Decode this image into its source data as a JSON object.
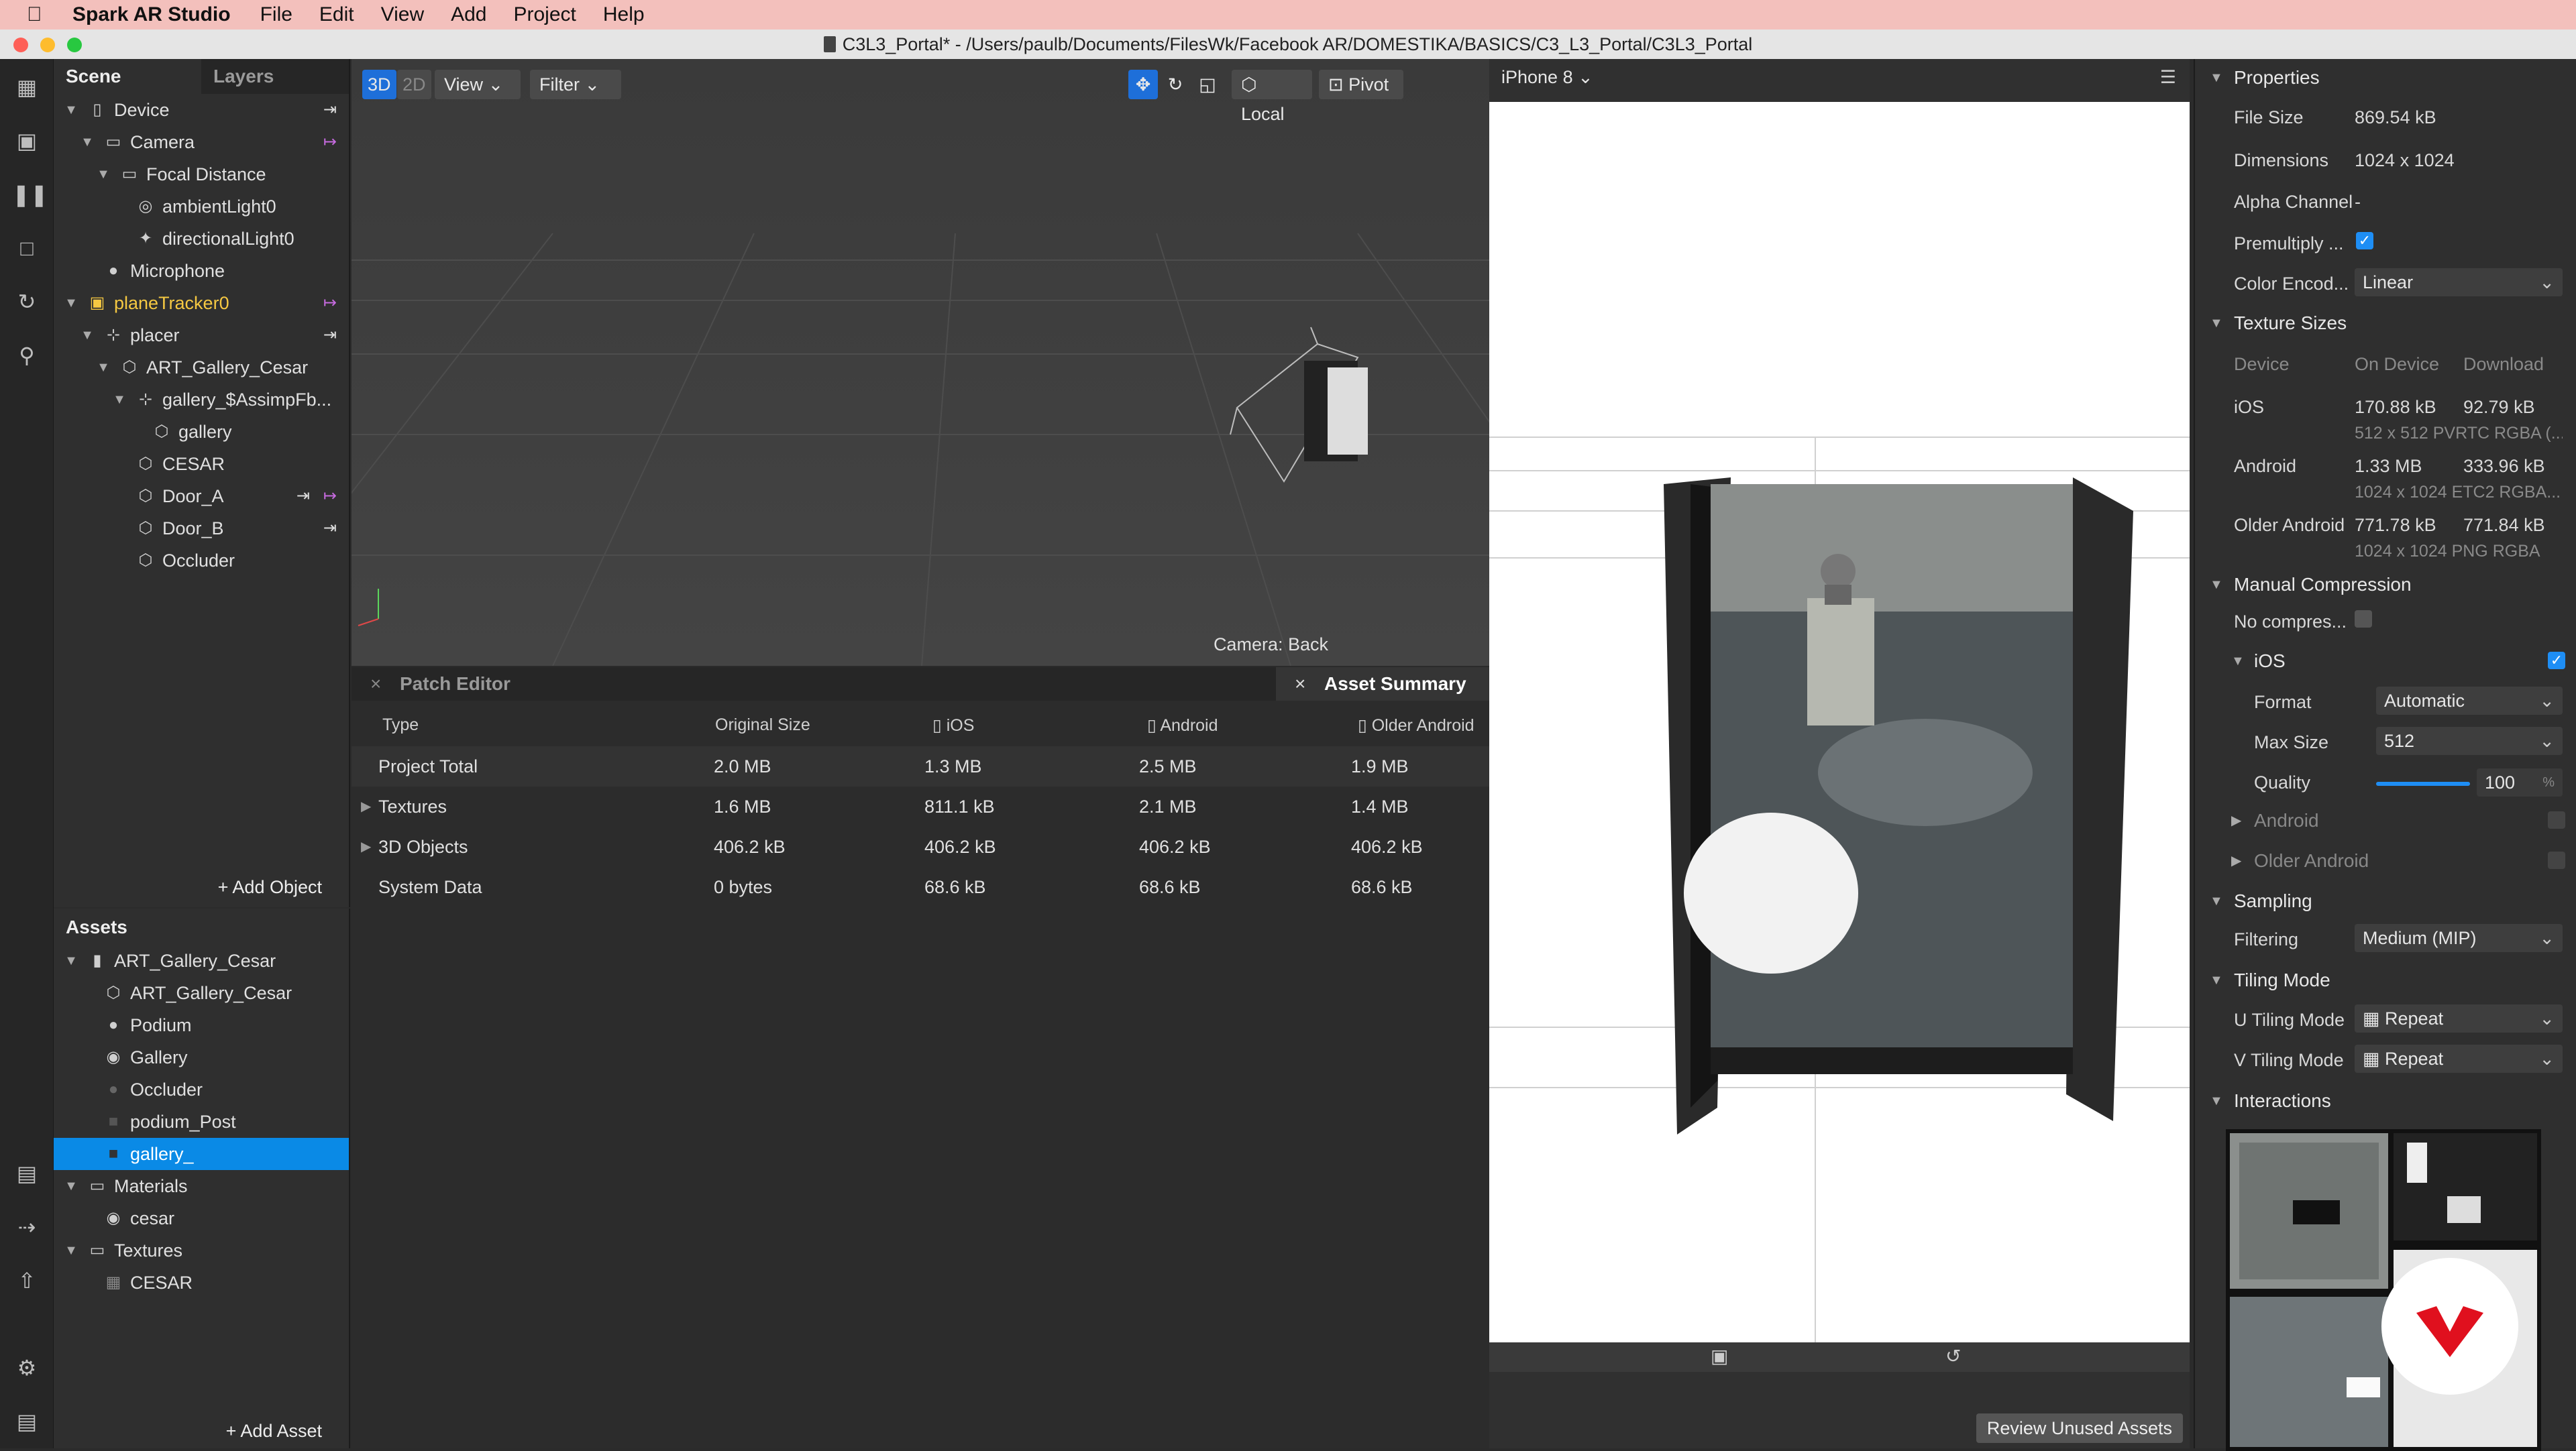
{
  "menubar": {
    "app": "Spark AR Studio",
    "items": [
      "File",
      "Edit",
      "View",
      "Add",
      "Project",
      "Help"
    ]
  },
  "title": "C3L3_Portal* - /Users/paulb/Documents/FilesWk/Facebook AR/DOMESTIKA/BASICS/C3_L3_Portal/C3L3_Portal",
  "scene": {
    "tab_scene": "Scene",
    "tab_layers": "Layers",
    "items": [
      {
        "label": "Device",
        "icon": "device-icon"
      },
      {
        "label": "Camera",
        "icon": "camera-icon"
      },
      {
        "label": "Focal Distance",
        "icon": "focal-icon"
      },
      {
        "label": "ambientLight0",
        "icon": "ambient-light-icon"
      },
      {
        "label": "directionalLight0",
        "icon": "directional-light-icon"
      },
      {
        "label": "Microphone",
        "icon": "microphone-icon"
      },
      {
        "label": "planeTracker0",
        "icon": "plane-tracker-icon"
      },
      {
        "label": "placer",
        "icon": "null-object-icon"
      },
      {
        "label": "ART_Gallery_Cesar",
        "icon": "3d-object-icon"
      },
      {
        "label": "gallery_$AssimpFb...",
        "icon": "null-object-icon"
      },
      {
        "label": "gallery",
        "icon": "mesh-icon"
      },
      {
        "label": "CESAR",
        "icon": "mesh-icon"
      },
      {
        "label": "Door_A",
        "icon": "mesh-icon"
      },
      {
        "label": "Door_B",
        "icon": "mesh-icon"
      },
      {
        "label": "Occluder",
        "icon": "mesh-icon"
      }
    ],
    "add_object": "+ Add Object"
  },
  "assets": {
    "title": "Assets",
    "items": [
      {
        "label": "ART_Gallery_Cesar",
        "icon": "file-icon"
      },
      {
        "label": "ART_Gallery_Cesar",
        "icon": "3d-object-icon"
      },
      {
        "label": "Podium",
        "icon": "material-sphere-icon"
      },
      {
        "label": "Gallery",
        "icon": "material-sphere-icon"
      },
      {
        "label": "Occluder",
        "icon": "material-sphere-icon"
      },
      {
        "label": "podium_Post",
        "icon": "texture-icon"
      },
      {
        "label": "gallery_",
        "icon": "texture-icon"
      },
      {
        "label": "Materials",
        "icon": "folder-icon"
      },
      {
        "label": "cesar",
        "icon": "material-sphere-icon"
      },
      {
        "label": "Textures",
        "icon": "folder-icon"
      },
      {
        "label": "CESAR",
        "icon": "texture-icon"
      }
    ],
    "add_asset": "+ Add Asset"
  },
  "viewport": {
    "mode_3d": "3D",
    "mode_2d": "2D",
    "view": "View",
    "filter": "Filter",
    "local": "Local",
    "pivot": "Pivot",
    "camera_label": "Camera: Back"
  },
  "bottom": {
    "patch_editor": "Patch Editor",
    "asset_summary": "Asset Summary",
    "columns": [
      "Type",
      "Original Size",
      "iOS",
      "Android",
      "Older Android"
    ],
    "rows": [
      [
        "Project Total",
        "2.0 MB",
        "1.3 MB",
        "2.5 MB",
        "1.9 MB"
      ],
      [
        "Textures",
        "1.6 MB",
        "811.1 kB",
        "2.1 MB",
        "1.4 MB"
      ],
      [
        "3D Objects",
        "406.2 kB",
        "406.2 kB",
        "406.2 kB",
        "406.2 kB"
      ],
      [
        "System Data",
        "0 bytes",
        "68.6 kB",
        "68.6 kB",
        "68.6 kB"
      ]
    ],
    "review": "Review Unused Assets"
  },
  "phone": {
    "device": "iPhone 8"
  },
  "properties": {
    "title": "Properties",
    "file_size_label": "File Size",
    "file_size": "869.54 kB",
    "dimensions_label": "Dimensions",
    "dimensions": "1024 x 1024",
    "alpha_label": "Alpha Channel",
    "alpha": "-",
    "premultiply_label": "Premultiply ...",
    "color_label": "Color Encod...",
    "color": "Linear",
    "texture_sizes": "Texture Sizes",
    "ts_headers": [
      "Device",
      "On Device",
      "Download"
    ],
    "ios": [
      "iOS",
      "170.88 kB",
      "92.79 kB",
      "512 x 512 PVRTC RGBA (..."
    ],
    "android": [
      "Android",
      "1.33 MB",
      "333.96 kB",
      "1024 x 1024 ETC2 RGBA..."
    ],
    "older": [
      "Older Android",
      "771.78 kB",
      "771.84 kB",
      "1024 x 1024 PNG RGBA"
    ],
    "manual": "Manual Compression",
    "no_compress": "No compres...",
    "ios_sec": "iOS",
    "format_label": "Format",
    "format": "Automatic",
    "max_label": "Max Size",
    "max": "512",
    "quality_label": "Quality",
    "quality": "100",
    "quality_unit": "%",
    "quality_level": 1.0,
    "android_sec": "Android",
    "older_sec": "Older Android",
    "sampling": "Sampling",
    "filtering_label": "Filtering",
    "filtering": "Medium (MIP)",
    "tiling": "Tiling Mode",
    "u_label": "U Tiling Mode",
    "u": "Repeat",
    "v_label": "V Tiling Mode",
    "v": "Repeat",
    "interactions": "Interactions"
  },
  "colors": {
    "accent": "#0a8ae6",
    "menubar": "#f3c0bc",
    "tracker": "#f5c842",
    "pin": "#c76be0"
  }
}
